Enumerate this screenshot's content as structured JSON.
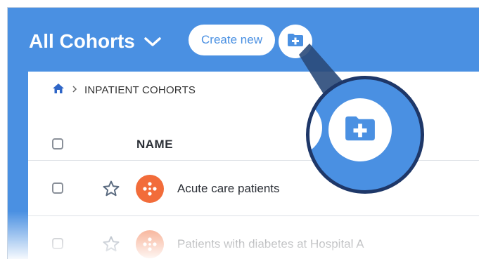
{
  "header": {
    "title": "All Cohorts",
    "create_button_label": "Create new"
  },
  "breadcrumb": {
    "items": [
      "INPATIENT COHORTS"
    ]
  },
  "table": {
    "column_name": "NAME",
    "rows": [
      {
        "name": "Acute care patients"
      },
      {
        "name": "Patients with diabetes at Hospital A"
      }
    ]
  },
  "colors": {
    "header_blue": "#4a90e2",
    "cohort_icon_orange": "#f26c3a",
    "callout_ring_navy": "#1e3768"
  },
  "icons": {
    "title_chevron": "chevron-down-icon",
    "add_folder": "folder-plus-icon",
    "home": "home-icon",
    "breadcrumb_separator": "chevron-right-icon",
    "favorite": "star-outline-icon",
    "cohort": "cohort-icon"
  }
}
